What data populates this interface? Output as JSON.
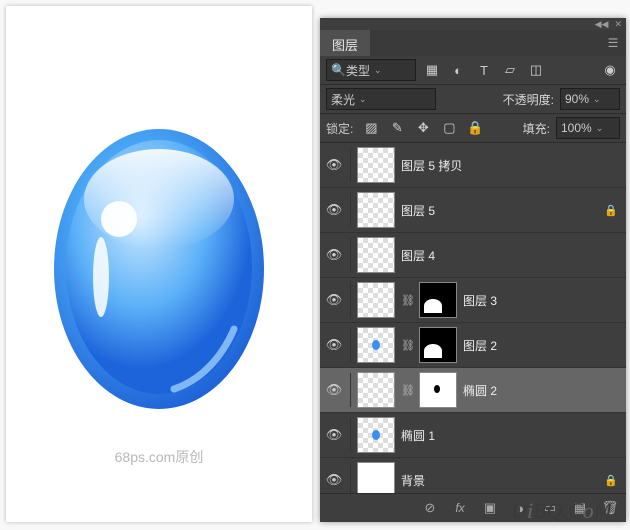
{
  "canvas": {
    "credit": "68ps.com原创"
  },
  "panel": {
    "tab_label": "图层",
    "filter": {
      "label": "类型"
    },
    "blend": {
      "mode": "柔光",
      "opacity_label": "不透明度:",
      "opacity_value": "90%"
    },
    "lock": {
      "label": "锁定:",
      "fill_label": "填充:",
      "fill_value": "100%"
    },
    "layers": [
      {
        "name": "图层 5 拷贝",
        "locked": false,
        "has_mask": false,
        "linked": false,
        "thumb": "trans",
        "selected": false
      },
      {
        "name": "图层 5",
        "locked": true,
        "has_mask": false,
        "linked": false,
        "thumb": "trans",
        "selected": false
      },
      {
        "name": "图层 4",
        "locked": false,
        "has_mask": false,
        "linked": false,
        "thumb": "trans",
        "selected": false
      },
      {
        "name": "图层 3",
        "locked": false,
        "has_mask": true,
        "linked": true,
        "thumb": "trans",
        "selected": false
      },
      {
        "name": "图层 2",
        "locked": false,
        "has_mask": true,
        "linked": true,
        "thumb": "trans-blue",
        "selected": false
      },
      {
        "name": "椭圆 2",
        "locked": false,
        "has_mask": true,
        "linked": true,
        "thumb": "trans",
        "selected": true,
        "mask_white": true
      },
      {
        "name": "椭圆 1",
        "locked": false,
        "has_mask": false,
        "linked": false,
        "thumb": "trans-blue",
        "selected": false
      },
      {
        "name": "背景",
        "locked": true,
        "has_mask": false,
        "linked": false,
        "thumb": "white",
        "selected": false
      }
    ],
    "footer_icons": [
      "link",
      "fx",
      "mask",
      "adjust",
      "group",
      "new",
      "trash"
    ]
  },
  "watermark": "UiBQ.CoM"
}
